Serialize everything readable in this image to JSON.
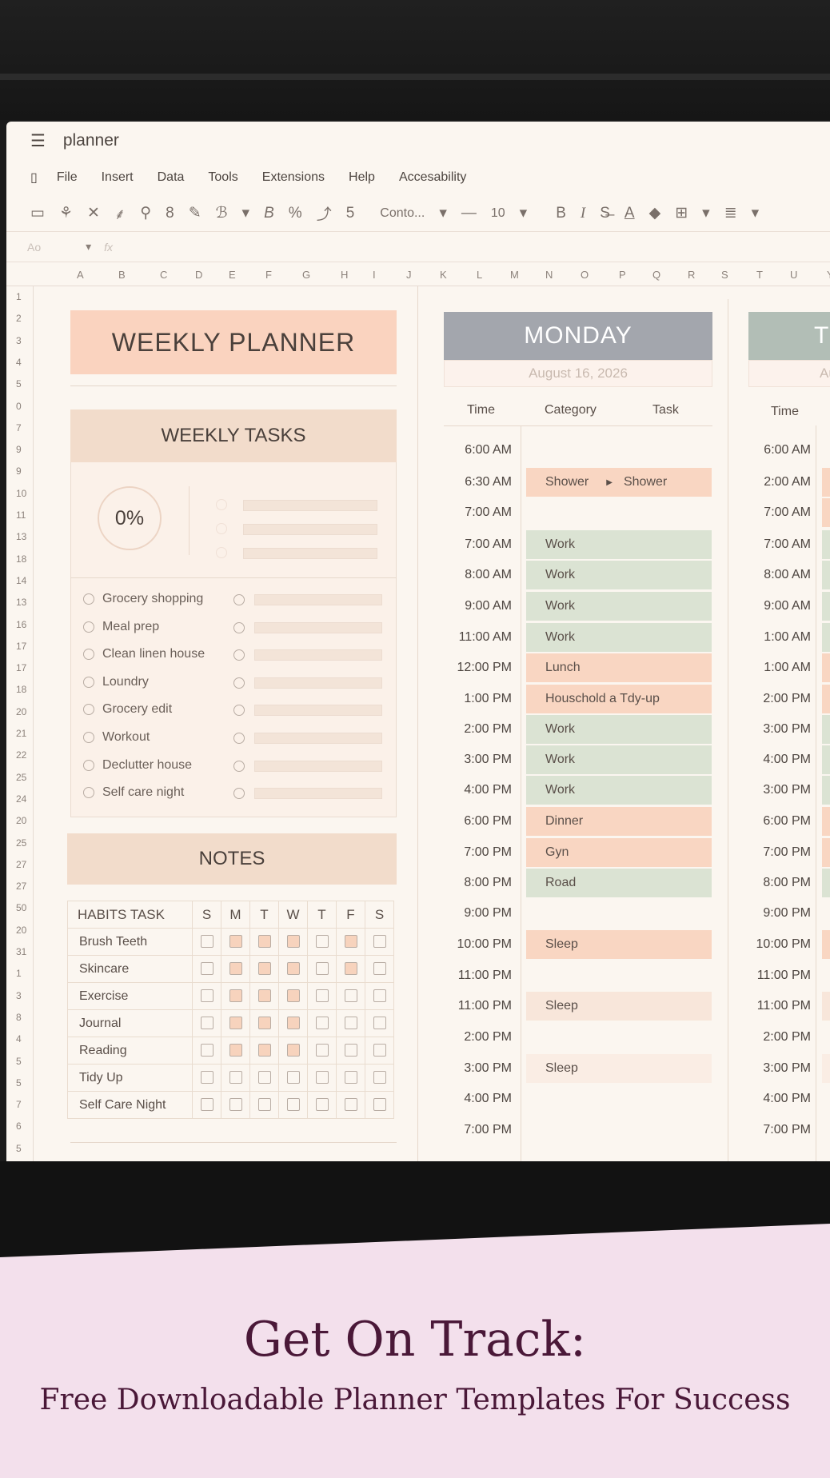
{
  "app": {
    "title": "planner"
  },
  "menu": [
    "File",
    "Insert",
    "Data",
    "Tools",
    "Extensions",
    "Help",
    "Accesability"
  ],
  "toolbar": {
    "font": "Conto...",
    "font_size": "10",
    "zoom_sep": "—",
    "five": "5",
    "percent": "%",
    "b": "B",
    "i": "I"
  },
  "formula": {
    "cell": "Ao",
    "fx": "fx"
  },
  "columns": [
    "A",
    "B",
    "C",
    "D",
    "E",
    "F",
    "G",
    "H",
    "I",
    "J",
    "K",
    "L",
    "M",
    "N",
    "O",
    "P",
    "Q",
    "R",
    "S",
    "T",
    "U",
    "Y"
  ],
  "rows": [
    "1",
    "2",
    "3",
    "4",
    "5",
    "0",
    "7",
    "9",
    "9",
    "10",
    "11",
    "13",
    "18",
    "14",
    "13",
    "16",
    "17",
    "17",
    "18",
    "20",
    "21",
    "22",
    "25",
    "24",
    "20",
    "25",
    "27",
    "27",
    "50",
    "20",
    "31",
    "1",
    "3",
    "8",
    "4",
    "5",
    "5",
    "7",
    "6",
    "5"
  ],
  "left": {
    "title": "WEEKLY PLANNER",
    "tasks_title": "WEEKLY TASKS",
    "progress": "0%",
    "tasks": [
      "Grocery shopping",
      "Meal prep",
      "Clean linen house",
      "Loundry",
      "Grocery edit",
      "Workout",
      "Declutter house",
      "Self care night"
    ],
    "notes_title": "NOTES",
    "habits_title": "HABITS TASK",
    "days": [
      "S",
      "M",
      "T",
      "W",
      "T",
      "F",
      "S"
    ],
    "habits": [
      {
        "name": "Brush Teeth",
        "fill": [
          0,
          1,
          1,
          1,
          0,
          1,
          0
        ]
      },
      {
        "name": "Skincare",
        "fill": [
          0,
          1,
          1,
          1,
          0,
          1,
          0
        ]
      },
      {
        "name": "Exercise",
        "fill": [
          0,
          1,
          1,
          1,
          0,
          0,
          0
        ]
      },
      {
        "name": "Journal",
        "fill": [
          0,
          1,
          1,
          1,
          0,
          0,
          0
        ]
      },
      {
        "name": "Reading",
        "fill": [
          0,
          1,
          1,
          1,
          0,
          0,
          0
        ]
      },
      {
        "name": "Tidy Up",
        "fill": [
          0,
          0,
          0,
          0,
          0,
          0,
          0
        ]
      },
      {
        "name": "Self Care Night",
        "fill": [
          0,
          0,
          0,
          0,
          0,
          0,
          0
        ]
      }
    ]
  },
  "monday": {
    "title": "MONDAY",
    "date": "August 16, 2026",
    "headers": {
      "time": "Time",
      "category": "Category",
      "task": "Task"
    },
    "rows": [
      {
        "time": "6:00 AM",
        "cat": "",
        "color": ""
      },
      {
        "time": "6:30 AM",
        "cat": "Shower",
        "task": "Shower",
        "color": "orange"
      },
      {
        "time": "7:00 AM",
        "cat": "",
        "color": ""
      },
      {
        "time": "7:00 AM",
        "cat": "Work",
        "color": "green"
      },
      {
        "time": "8:00 AM",
        "cat": "Work",
        "color": "green"
      },
      {
        "time": "9:00 AM",
        "cat": "Work",
        "color": "green"
      },
      {
        "time": "11:00 AM",
        "cat": "Work",
        "color": "green"
      },
      {
        "time": "12:00 PM",
        "cat": "Lunch",
        "color": "orange"
      },
      {
        "time": "1:00 PM",
        "cat": "Houschold a Tdy-up",
        "color": "orange"
      },
      {
        "time": "2:00 PM",
        "cat": "Work",
        "color": "green"
      },
      {
        "time": "3:00 PM",
        "cat": "Work",
        "color": "green"
      },
      {
        "time": "4:00 PM",
        "cat": "Work",
        "color": "green"
      },
      {
        "time": "6:00 PM",
        "cat": "Dinner",
        "color": "orange"
      },
      {
        "time": "7:00 PM",
        "cat": "Gyn",
        "color": "orange"
      },
      {
        "time": "8:00 PM",
        "cat": "Road",
        "color": "green"
      },
      {
        "time": "9:00 PM",
        "cat": "",
        "color": ""
      },
      {
        "time": "10:00 PM",
        "cat": "Sleep",
        "color": "orange"
      },
      {
        "time": "11:00 PM",
        "cat": "",
        "color": ""
      },
      {
        "time": "11:00 PM",
        "cat": "Sleep",
        "color": "lightor"
      },
      {
        "time": "2:00 PM",
        "cat": "",
        "color": ""
      },
      {
        "time": "3:00 PM",
        "cat": "Sleep",
        "color": "faint"
      },
      {
        "time": "4:00 PM",
        "cat": "",
        "color": ""
      },
      {
        "time": "7:00 PM",
        "cat": "",
        "color": ""
      }
    ]
  },
  "tuesday": {
    "title": "T",
    "date": "Au",
    "header_time": "Time",
    "times": [
      "6:00 AM",
      "2:00 AM",
      "7:00 AM",
      "7:00 AM",
      "8:00 AM",
      "9:00 AM",
      "1:00 AM",
      "1:00 AM",
      "2:00 PM",
      "3:00 PM",
      "4:00 PM",
      "3:00 PM",
      "6:00 PM",
      "7:00 PM",
      "8:00 PM",
      "9:00 PM",
      "10:00 PM",
      "11:00 PM",
      "11:00 PM",
      "2:00 PM",
      "3:00 PM",
      "4:00 PM",
      "7:00 PM"
    ]
  },
  "banner": {
    "line1": "Get On Track:",
    "line2": "Free Downloadable Planner Templates For Success"
  },
  "colors": {
    "banner_bg": "#f3e0ec",
    "banner_text": "#4a1838",
    "monday_header": "#a3a6ad",
    "tuesday_header": "#b2beb6",
    "planner_header": "#fad3bf",
    "tasks_header": "#f2dccb"
  }
}
